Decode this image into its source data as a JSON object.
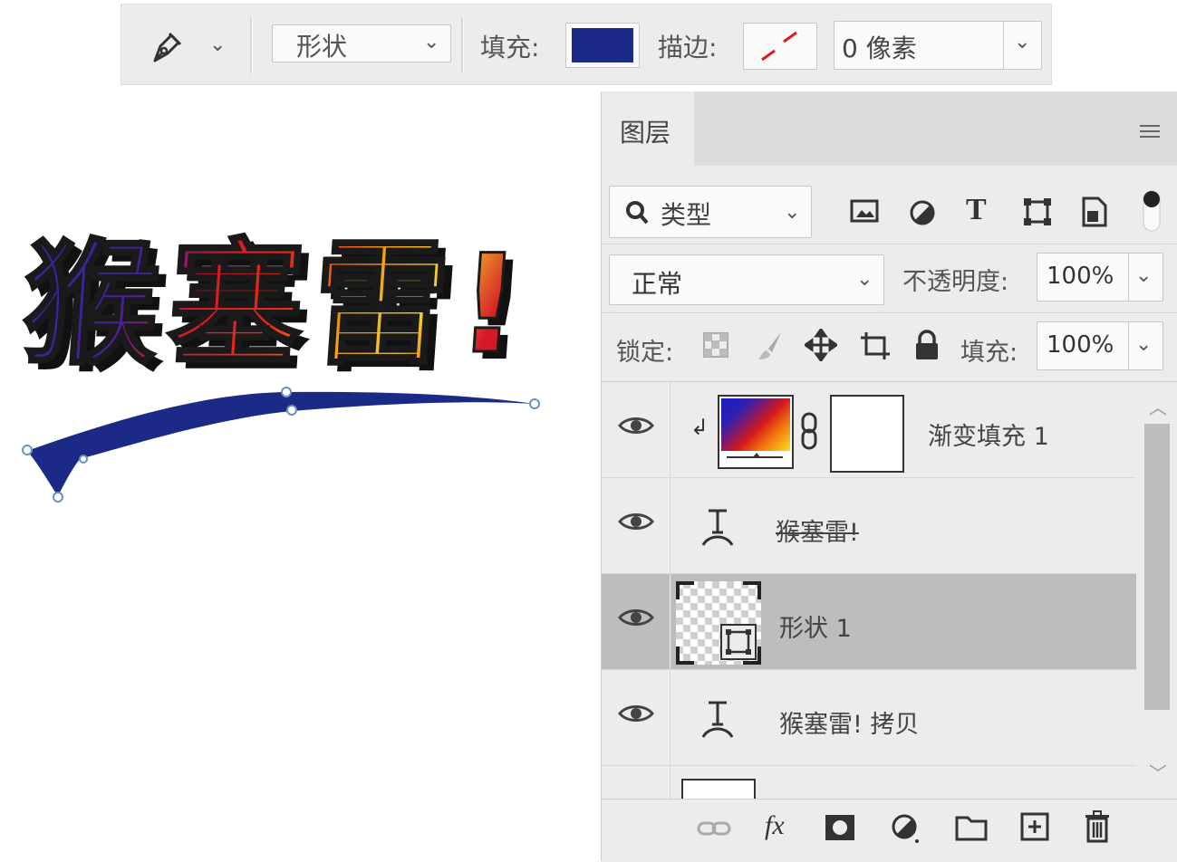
{
  "options_bar": {
    "tool_mode": "形状",
    "fill_label": "填充:",
    "fill_color": "#1b2a87",
    "stroke_label": "描边:",
    "stroke_width": "0 像素"
  },
  "canvas": {
    "artwork_text": "猴塞雷!",
    "path_color": "#1b2a87"
  },
  "layers_panel": {
    "tab": "图层",
    "filter_kind": "类型",
    "blend_mode": "正常",
    "opacity_label": "不透明度:",
    "opacity_value": "100%",
    "lock_label": "锁定:",
    "fill_label": "填充:",
    "fill_value": "100%",
    "layers": [
      {
        "name": "渐变填充 1",
        "type": "gradient-fill",
        "visible": true,
        "selected": false
      },
      {
        "name": "猴塞雷!",
        "type": "text",
        "visible": true,
        "selected": false
      },
      {
        "name": "形状 1",
        "type": "shape",
        "visible": true,
        "selected": true
      },
      {
        "name": "猴塞雷! 拷贝",
        "type": "text",
        "visible": true,
        "selected": false
      }
    ],
    "footer_icons": [
      "link-icon",
      "fx-icon",
      "mask-icon",
      "adjustment-icon",
      "folder-icon",
      "new-layer-icon",
      "trash-icon"
    ]
  }
}
